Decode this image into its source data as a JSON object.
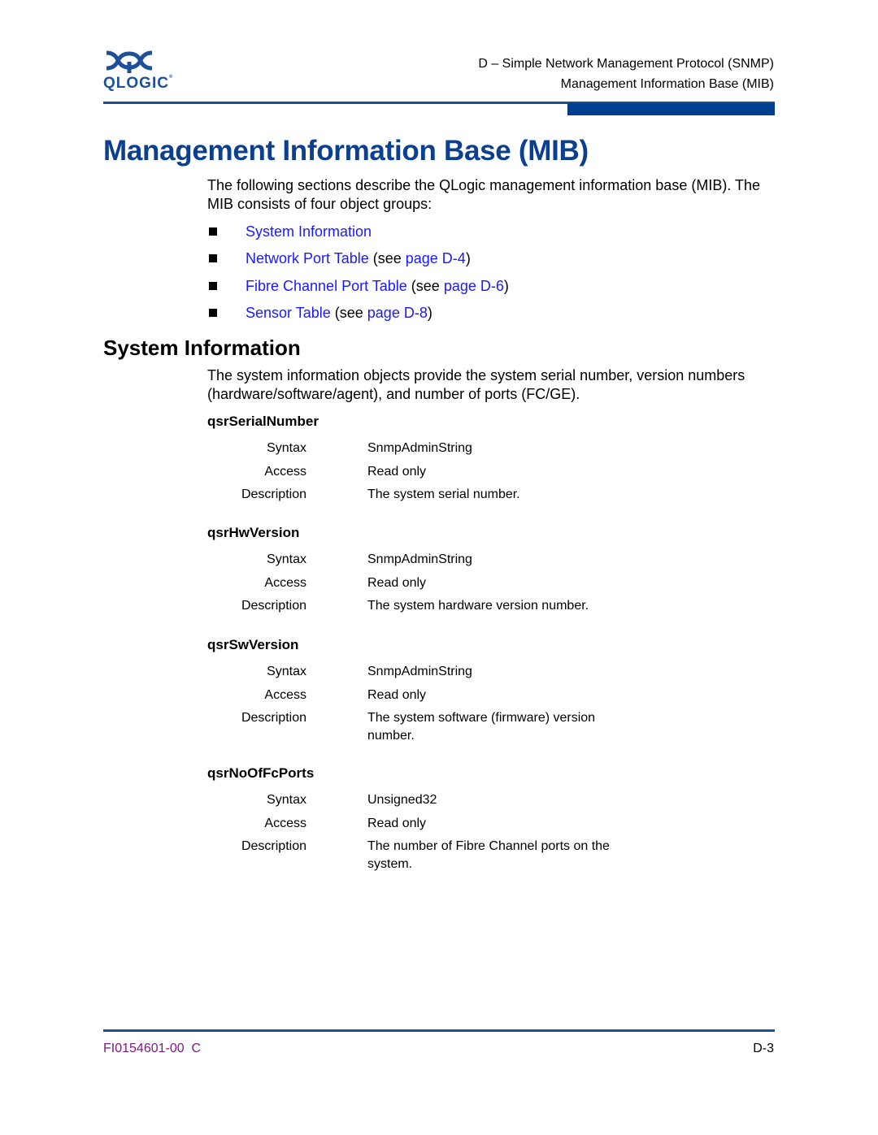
{
  "header": {
    "logo_text": "QLOGIC",
    "logo_reg": "®",
    "chapter": "D – Simple Network Management Protocol (SNMP)",
    "section": "Management Information Base (MIB)"
  },
  "colors": {
    "title_blue": "#0b3f8f",
    "rule_blue": "#1a4f95",
    "link_blue": "#1a1aff",
    "footer_purple": "#7b1a7e"
  },
  "page_title": "Management Information Base (MIB)",
  "intro": "The following sections describe the QLogic management information base (MIB). The MIB consists of four object groups:",
  "bullets": [
    {
      "link": "System Information",
      "pre": "",
      "page_link": "",
      "post": ""
    },
    {
      "link": "Network Port Table",
      "pre": " (see ",
      "page_link": "page D-4",
      "post": ")"
    },
    {
      "link": "Fibre Channel Port Table",
      "pre": " (see ",
      "page_link": "page D-6",
      "post": ")"
    },
    {
      "link": "Sensor Table",
      "pre": " (see ",
      "page_link": "page D-8",
      "post": ")"
    }
  ],
  "section": {
    "title": "System Information",
    "intro": "The system information objects provide the system serial number, version numbers (hardware/software/agent), and number of ports (FC/GE).",
    "objects": [
      {
        "name": "qsrSerialNumber",
        "rows": [
          {
            "label": "Syntax",
            "value": "SnmpAdminString"
          },
          {
            "label": "Access",
            "value": "Read only"
          },
          {
            "label": "Description",
            "value": "The system serial number."
          }
        ]
      },
      {
        "name": "qsrHwVersion",
        "rows": [
          {
            "label": "Syntax",
            "value": "SnmpAdminString"
          },
          {
            "label": "Access",
            "value": "Read only"
          },
          {
            "label": "Description",
            "value": "The system hardware version number."
          }
        ]
      },
      {
        "name": "qsrSwVersion",
        "rows": [
          {
            "label": "Syntax",
            "value": "SnmpAdminString"
          },
          {
            "label": "Access",
            "value": "Read only"
          },
          {
            "label": "Description",
            "value": "The system software (firmware) version number."
          }
        ]
      },
      {
        "name": "qsrNoOfFcPorts",
        "rows": [
          {
            "label": "Syntax",
            "value": "Unsigned32"
          },
          {
            "label": "Access",
            "value": "Read only"
          },
          {
            "label": "Description",
            "value": "The number of Fibre Channel ports on the system."
          }
        ]
      }
    ]
  },
  "footer": {
    "doc_number": "FI0154601-00  C",
    "page_number": "D-3"
  }
}
